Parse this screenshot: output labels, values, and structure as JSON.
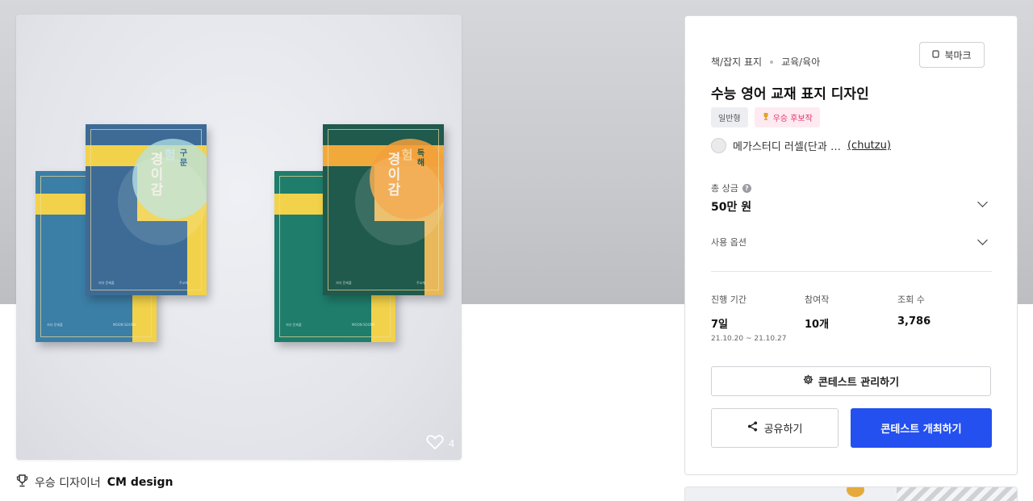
{
  "artwork": {
    "books": [
      {
        "title_main": "경이감",
        "title_sub1": "험",
        "title_sub2": "구문",
        "footer_left": "저자 문제풀",
        "footer_right": "주교재",
        "spine_text": "MOON SOOPH"
      },
      {
        "title_main": "경이감",
        "title_sub1": "험",
        "title_sub2": "독해",
        "footer_left": "저자 문제풀",
        "footer_right": "주교재",
        "spine_text": "MOON SOOPH"
      }
    ],
    "like_count": "4",
    "colors": {
      "blue_book": "#3a6d96",
      "teal_book": "#1f5a4d",
      "yellow": "#f2d24a",
      "orange": "#f2a93b"
    }
  },
  "winner": {
    "prefix": "우승 디자이너",
    "name": "CM design"
  },
  "panel": {
    "category": "책/잡지 표지",
    "subcategory": "교육/육아",
    "bookmark_label": "북마크",
    "title": "수능 영어 교재 표지 디자인",
    "badges": {
      "type": "일반형",
      "candidate": "우승 후보작"
    },
    "client": {
      "name": "메가스터디 러셀(단과 …",
      "handle": "(chutzu)"
    },
    "prize": {
      "label": "총 상금",
      "value": "50만 원"
    },
    "usage_label": "사용 옵션",
    "stats": {
      "period": {
        "label": "진행 기간",
        "value": "7일",
        "dates": "21.10.20 ~ 21.10.27"
      },
      "entries": {
        "label": "참여작",
        "value": "10개"
      },
      "views": {
        "label": "조회 수",
        "value": "3,786"
      }
    },
    "manage_button": "콘테스트 관리하기",
    "share_button": "공유하기",
    "host_button": "콘테스트 개최하기",
    "accent": "#2350ef"
  }
}
